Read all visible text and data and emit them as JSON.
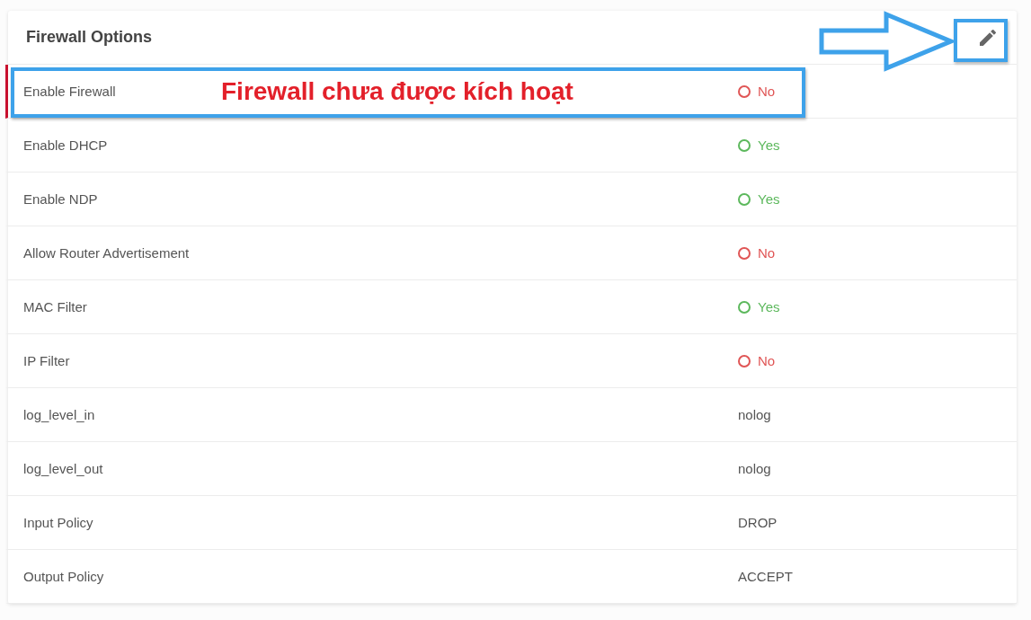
{
  "card": {
    "title": "Firewall Options",
    "edit_button": {
      "highlighted": true
    }
  },
  "rows": [
    {
      "label": "Enable Firewall",
      "kind": "status",
      "on": false,
      "value": "No",
      "highlighted": true
    },
    {
      "label": "Enable DHCP",
      "kind": "status",
      "on": true,
      "value": "Yes",
      "highlighted": false
    },
    {
      "label": "Enable NDP",
      "kind": "status",
      "on": true,
      "value": "Yes",
      "highlighted": false
    },
    {
      "label": "Allow Router Advertisement",
      "kind": "status",
      "on": false,
      "value": "No",
      "highlighted": false
    },
    {
      "label": "MAC Filter",
      "kind": "status",
      "on": true,
      "value": "Yes",
      "highlighted": false
    },
    {
      "label": "IP Filter",
      "kind": "status",
      "on": false,
      "value": "No",
      "highlighted": false
    },
    {
      "label": "log_level_in",
      "kind": "text",
      "value": "nolog",
      "highlighted": false
    },
    {
      "label": "log_level_out",
      "kind": "text",
      "value": "nolog",
      "highlighted": false
    },
    {
      "label": "Input Policy",
      "kind": "text",
      "value": "DROP",
      "highlighted": false
    },
    {
      "label": "Output Policy",
      "kind": "text",
      "value": "ACCEPT",
      "highlighted": false
    }
  ],
  "annotation": {
    "text": "Firewall chưa được kích hoạt"
  }
}
